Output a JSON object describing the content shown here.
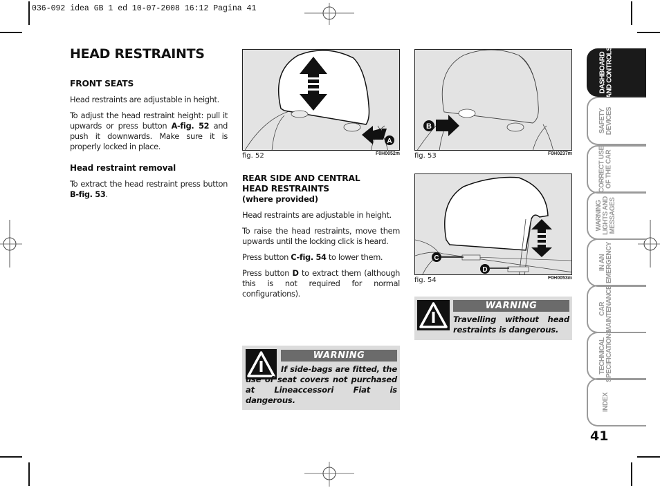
{
  "slug": "036-092 idea GB 1 ed  10-07-2008  16:12  Pagina 41",
  "page_title": "HEAD RESTRAINTS",
  "left_column": {
    "front_seats_heading": "FRONT SEATS",
    "p1": "Head restraints are adjustable in height.",
    "p2_before": "To adjust the head restraint height: pull it upwards or press button ",
    "p2_bold": "A-fig. 52",
    "p2_after": " and push it downwards. Make sure it is properly locked in place.",
    "removal_heading": "Head restraint removal",
    "p3_before": "To extract the head restraint press button ",
    "p3_bold": "B-fig. 53",
    "p3_after": "."
  },
  "middle_column": {
    "heading_line1": "REAR SIDE AND CENTRAL",
    "heading_line2": "HEAD RESTRAINTS",
    "heading_sub": "(where provided)",
    "p1": "Head restraints are adjustable in height.",
    "p2": "To raise the head restraints, move them upwards until the locking click is heard.",
    "p3_before": "Press button ",
    "p3_bold": "C-fig. 54",
    "p3_after": " to lower them.",
    "p4_before": "Press button ",
    "p4_bold": "D",
    "p4_after": " to extract them (although this is not required for normal configurations)."
  },
  "figures": [
    {
      "caption": "fig. 52",
      "code": "F0H0052m",
      "callouts": [
        "A"
      ]
    },
    {
      "caption": "fig. 53",
      "code": "F0H0237m",
      "callouts": [
        "B"
      ]
    },
    {
      "caption": "fig. 54",
      "code": "F0H0053m",
      "callouts": [
        "C",
        "D"
      ]
    }
  ],
  "warnings": [
    {
      "title": "WARNING",
      "text": "If side-bags are fitted, the use of seat covers not purchased at Lineaccessori Fiat is dangerous."
    },
    {
      "title": "WARNING",
      "text": "Travelling without head restraints is dangerous."
    }
  ],
  "tabs": [
    {
      "label": "DASHBOARD\nAND CONTROLS",
      "active": true
    },
    {
      "label": "SAFETY\nDEVICES",
      "active": false
    },
    {
      "label": "CORRECT USE\nOF THE CAR",
      "active": false
    },
    {
      "label": "WARNING\nLIGHTS AND\nMESSAGES",
      "active": false
    },
    {
      "label": "IN AN\nEMERGENCY",
      "active": false
    },
    {
      "label": "CAR\nMAINTENANCE",
      "active": false
    },
    {
      "label": "TECHNICAL\nSPECIFICATIONS",
      "active": false
    },
    {
      "label": "INDEX",
      "active": false
    }
  ],
  "page_number": "41"
}
